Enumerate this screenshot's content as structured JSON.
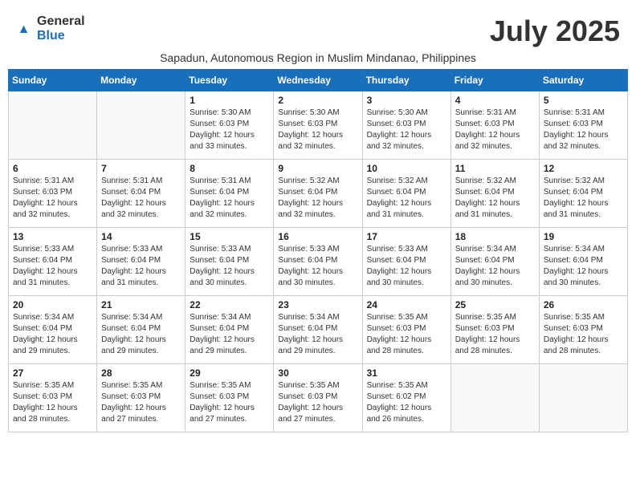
{
  "header": {
    "logo_general": "General",
    "logo_blue": "Blue",
    "month_title": "July 2025",
    "subtitle": "Sapadun, Autonomous Region in Muslim Mindanao, Philippines"
  },
  "weekdays": [
    "Sunday",
    "Monday",
    "Tuesday",
    "Wednesday",
    "Thursday",
    "Friday",
    "Saturday"
  ],
  "weeks": [
    [
      {
        "day": "",
        "info": ""
      },
      {
        "day": "",
        "info": ""
      },
      {
        "day": "1",
        "info": "Sunrise: 5:30 AM\nSunset: 6:03 PM\nDaylight: 12 hours and 33 minutes."
      },
      {
        "day": "2",
        "info": "Sunrise: 5:30 AM\nSunset: 6:03 PM\nDaylight: 12 hours and 32 minutes."
      },
      {
        "day": "3",
        "info": "Sunrise: 5:30 AM\nSunset: 6:03 PM\nDaylight: 12 hours and 32 minutes."
      },
      {
        "day": "4",
        "info": "Sunrise: 5:31 AM\nSunset: 6:03 PM\nDaylight: 12 hours and 32 minutes."
      },
      {
        "day": "5",
        "info": "Sunrise: 5:31 AM\nSunset: 6:03 PM\nDaylight: 12 hours and 32 minutes."
      }
    ],
    [
      {
        "day": "6",
        "info": "Sunrise: 5:31 AM\nSunset: 6:03 PM\nDaylight: 12 hours and 32 minutes."
      },
      {
        "day": "7",
        "info": "Sunrise: 5:31 AM\nSunset: 6:04 PM\nDaylight: 12 hours and 32 minutes."
      },
      {
        "day": "8",
        "info": "Sunrise: 5:31 AM\nSunset: 6:04 PM\nDaylight: 12 hours and 32 minutes."
      },
      {
        "day": "9",
        "info": "Sunrise: 5:32 AM\nSunset: 6:04 PM\nDaylight: 12 hours and 32 minutes."
      },
      {
        "day": "10",
        "info": "Sunrise: 5:32 AM\nSunset: 6:04 PM\nDaylight: 12 hours and 31 minutes."
      },
      {
        "day": "11",
        "info": "Sunrise: 5:32 AM\nSunset: 6:04 PM\nDaylight: 12 hours and 31 minutes."
      },
      {
        "day": "12",
        "info": "Sunrise: 5:32 AM\nSunset: 6:04 PM\nDaylight: 12 hours and 31 minutes."
      }
    ],
    [
      {
        "day": "13",
        "info": "Sunrise: 5:33 AM\nSunset: 6:04 PM\nDaylight: 12 hours and 31 minutes."
      },
      {
        "day": "14",
        "info": "Sunrise: 5:33 AM\nSunset: 6:04 PM\nDaylight: 12 hours and 31 minutes."
      },
      {
        "day": "15",
        "info": "Sunrise: 5:33 AM\nSunset: 6:04 PM\nDaylight: 12 hours and 30 minutes."
      },
      {
        "day": "16",
        "info": "Sunrise: 5:33 AM\nSunset: 6:04 PM\nDaylight: 12 hours and 30 minutes."
      },
      {
        "day": "17",
        "info": "Sunrise: 5:33 AM\nSunset: 6:04 PM\nDaylight: 12 hours and 30 minutes."
      },
      {
        "day": "18",
        "info": "Sunrise: 5:34 AM\nSunset: 6:04 PM\nDaylight: 12 hours and 30 minutes."
      },
      {
        "day": "19",
        "info": "Sunrise: 5:34 AM\nSunset: 6:04 PM\nDaylight: 12 hours and 30 minutes."
      }
    ],
    [
      {
        "day": "20",
        "info": "Sunrise: 5:34 AM\nSunset: 6:04 PM\nDaylight: 12 hours and 29 minutes."
      },
      {
        "day": "21",
        "info": "Sunrise: 5:34 AM\nSunset: 6:04 PM\nDaylight: 12 hours and 29 minutes."
      },
      {
        "day": "22",
        "info": "Sunrise: 5:34 AM\nSunset: 6:04 PM\nDaylight: 12 hours and 29 minutes."
      },
      {
        "day": "23",
        "info": "Sunrise: 5:34 AM\nSunset: 6:04 PM\nDaylight: 12 hours and 29 minutes."
      },
      {
        "day": "24",
        "info": "Sunrise: 5:35 AM\nSunset: 6:03 PM\nDaylight: 12 hours and 28 minutes."
      },
      {
        "day": "25",
        "info": "Sunrise: 5:35 AM\nSunset: 6:03 PM\nDaylight: 12 hours and 28 minutes."
      },
      {
        "day": "26",
        "info": "Sunrise: 5:35 AM\nSunset: 6:03 PM\nDaylight: 12 hours and 28 minutes."
      }
    ],
    [
      {
        "day": "27",
        "info": "Sunrise: 5:35 AM\nSunset: 6:03 PM\nDaylight: 12 hours and 28 minutes."
      },
      {
        "day": "28",
        "info": "Sunrise: 5:35 AM\nSunset: 6:03 PM\nDaylight: 12 hours and 27 minutes."
      },
      {
        "day": "29",
        "info": "Sunrise: 5:35 AM\nSunset: 6:03 PM\nDaylight: 12 hours and 27 minutes."
      },
      {
        "day": "30",
        "info": "Sunrise: 5:35 AM\nSunset: 6:03 PM\nDaylight: 12 hours and 27 minutes."
      },
      {
        "day": "31",
        "info": "Sunrise: 5:35 AM\nSunset: 6:02 PM\nDaylight: 12 hours and 26 minutes."
      },
      {
        "day": "",
        "info": ""
      },
      {
        "day": "",
        "info": ""
      }
    ]
  ]
}
